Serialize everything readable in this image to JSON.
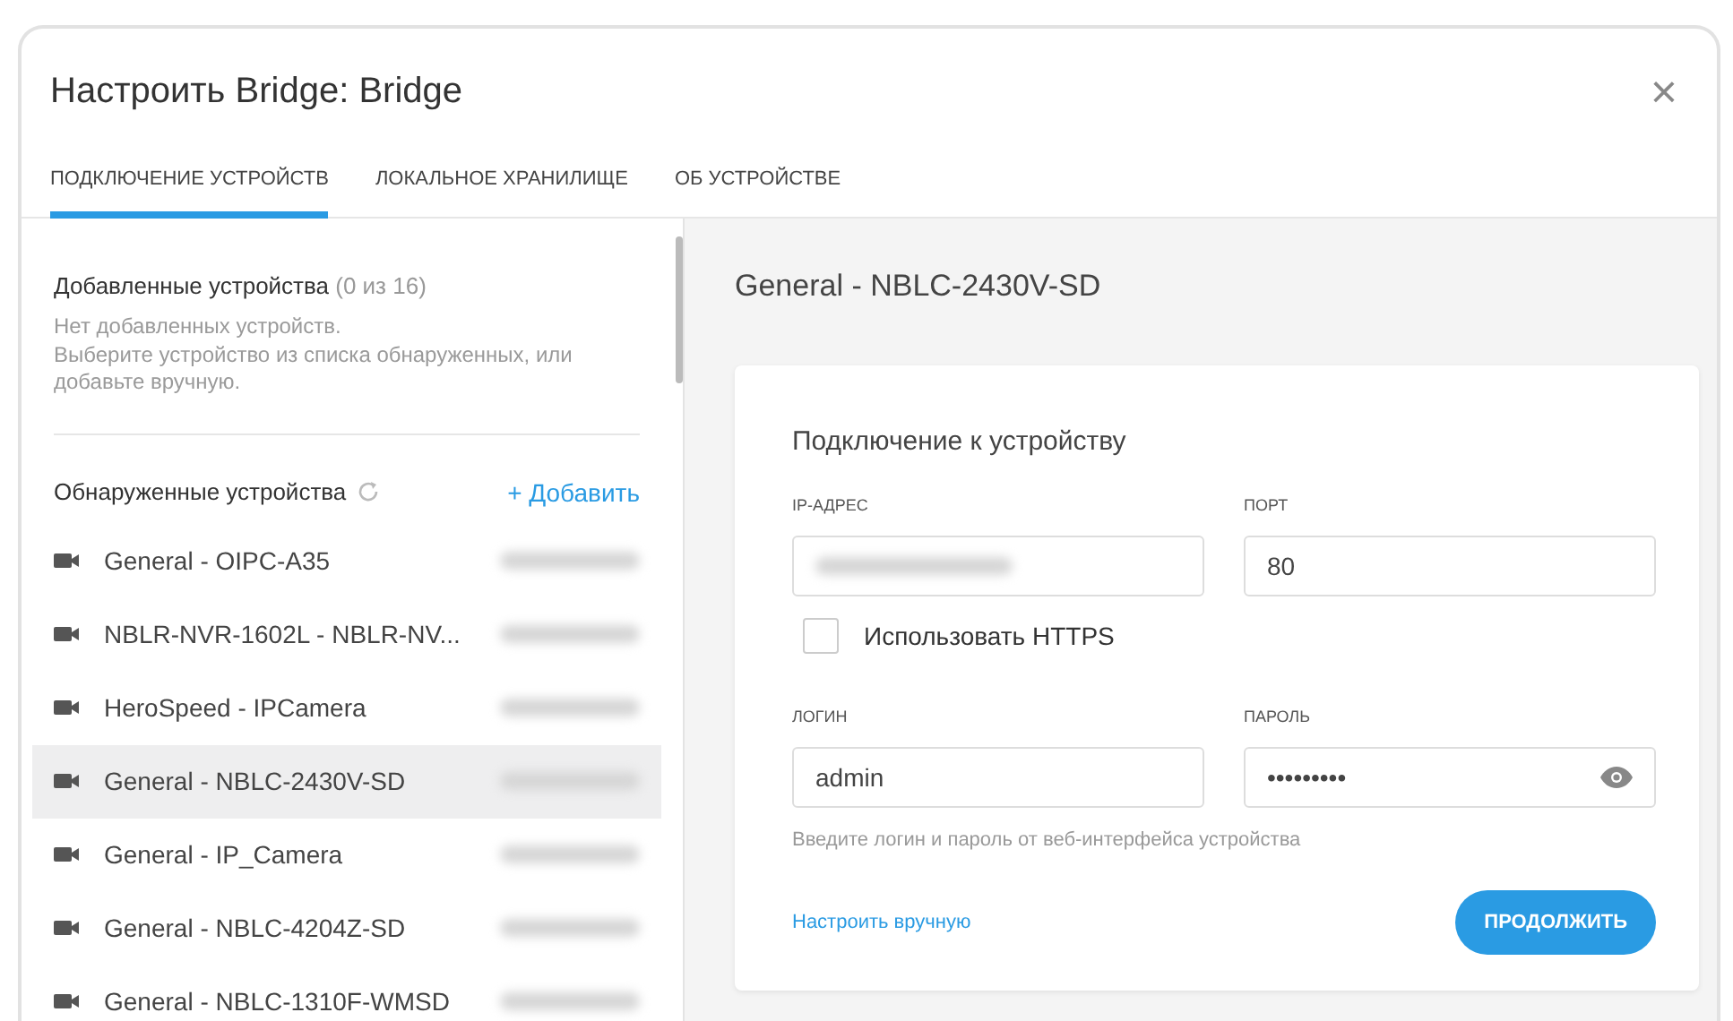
{
  "dialog": {
    "title": "Настроить Bridge: Bridge",
    "close": "×"
  },
  "tabs": [
    {
      "label": "ПОДКЛЮЧЕНИЕ УСТРОЙСТВ",
      "selected": true
    },
    {
      "label": "ЛОКАЛЬНОЕ ХРАНИЛИЩЕ",
      "selected": false
    },
    {
      "label": "ОБ УСТРОЙСТВЕ",
      "selected": false
    }
  ],
  "added": {
    "title": "Добавленные устройства",
    "count": "(0 из 16)",
    "empty_text": "Нет добавленных устройств.\nВыберите устройство из списка обнаруженных, или добавьте вручную."
  },
  "discovered": {
    "title": "Обнаруженные устройства",
    "add_link": "+ Добавить",
    "devices": [
      {
        "name": "General - OIPC-A35",
        "selected": false
      },
      {
        "name": "NBLR-NVR-1602L - NBLR-NV...",
        "selected": false
      },
      {
        "name": "HeroSpeed - IPCamera",
        "selected": false
      },
      {
        "name": "General - NBLC-2430V-SD",
        "selected": true
      },
      {
        "name": "General - IP_Camera",
        "selected": false
      },
      {
        "name": "General - NBLC-4204Z-SD",
        "selected": false
      },
      {
        "name": "General - NBLC-1310F-WMSD",
        "selected": false
      }
    ]
  },
  "detail": {
    "title": "General - NBLC-2430V-SD",
    "section_title": "Подключение к устройству",
    "ip_label": "IP-АДРЕС",
    "port_label": "ПОРТ",
    "port_value": "80",
    "https": {
      "label": "Использовать HTTPS",
      "checked": false
    },
    "login_label": "ЛОГИН",
    "login_value": "admin",
    "password_label": "ПАРОЛЬ",
    "password_value": "•••••••••",
    "hint": "Введите логин и пароль от веб-интерфейса устройства",
    "manual_link": "Настроить вручную",
    "continue_button": "ПРОДОЛЖИТЬ"
  }
}
